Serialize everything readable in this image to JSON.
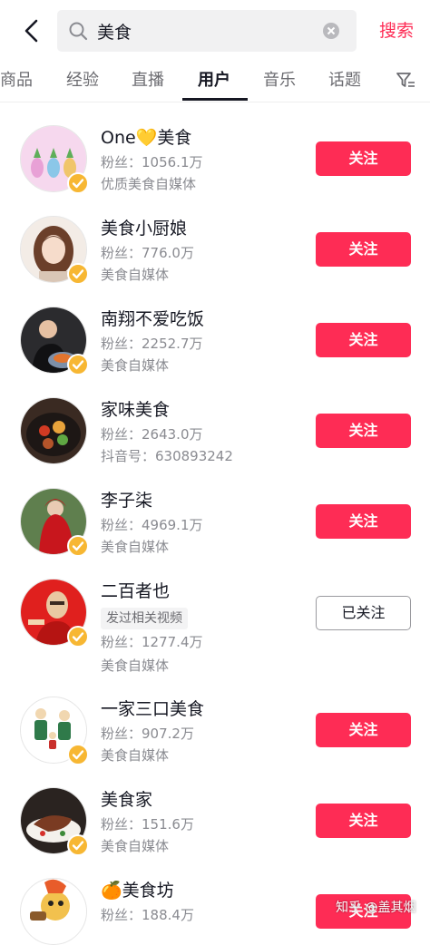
{
  "search": {
    "query": "美食",
    "submit_label": "搜索"
  },
  "tabs": [
    {
      "label": "商品"
    },
    {
      "label": "经验"
    },
    {
      "label": "直播"
    },
    {
      "label": "用户"
    },
    {
      "label": "音乐"
    },
    {
      "label": "话题"
    }
  ],
  "active_tab": "用户",
  "colors": {
    "accent": "#fe2c55",
    "verified": "#f7b733"
  },
  "users": [
    {
      "name": "One💛美食",
      "fans": "粉丝：1056.1万",
      "desc": "优质美食自媒体",
      "follow": "关注",
      "avatar_icon": "pineapples-icon"
    },
    {
      "name": "美食小厨娘",
      "fans": "粉丝：776.0万",
      "desc": "美食自媒体",
      "follow": "关注",
      "avatar_icon": "girl-portrait-icon"
    },
    {
      "name": "南翔不爱吃饭",
      "fans": "粉丝：2252.7万",
      "desc": "美食自媒体",
      "follow": "关注",
      "avatar_icon": "man-eating-icon"
    },
    {
      "name": "家味美食",
      "fans": "粉丝：2643.0万",
      "desc": "抖音号：630893242",
      "follow": "关注",
      "avatar_icon": "dish-icon"
    },
    {
      "name": "李子柒",
      "fans": "粉丝：4969.1万",
      "desc": "美食自媒体",
      "follow": "关注",
      "avatar_icon": "red-cloak-icon"
    },
    {
      "name": "二百者也",
      "tag": "发过相关视频",
      "fans": "粉丝：1277.4万",
      "desc": "美食自媒体",
      "follow": "已关注",
      "avatar_icon": "masked-man-icon"
    },
    {
      "name": "一家三口美食",
      "fans": "粉丝：907.2万",
      "desc": "美食自媒体",
      "follow": "关注",
      "avatar_icon": "family-cartoon-icon"
    },
    {
      "name": "美食家",
      "fans": "粉丝：151.6万",
      "desc": "美食自媒体",
      "follow": "关注",
      "avatar_icon": "steak-icon"
    },
    {
      "name": "🍊美食坊",
      "fans": "粉丝：188.4万",
      "desc": "",
      "follow": "关注",
      "avatar_icon": "cartoon-chef-icon"
    }
  ],
  "watermark": "知乎 @盖其烟"
}
